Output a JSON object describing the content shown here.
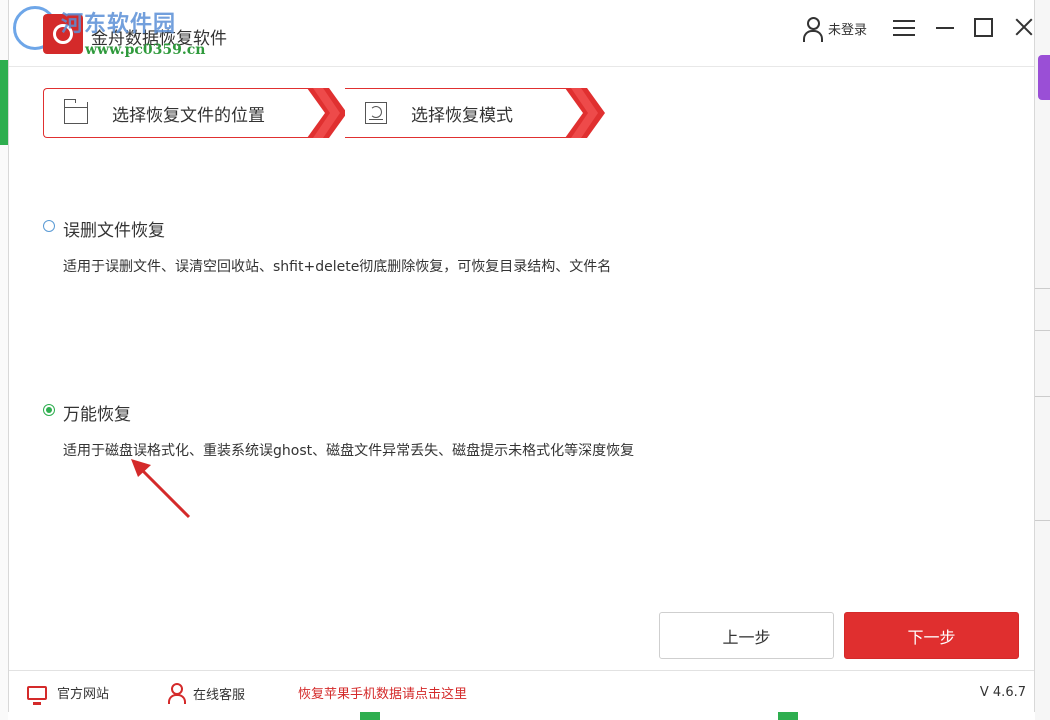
{
  "watermark": {
    "site_name": "河东软件园",
    "url": "www.pc0359.cn"
  },
  "app": {
    "title": "金舟数据恢复软件"
  },
  "user": {
    "login_label": "未登录"
  },
  "steps": [
    {
      "label": "选择恢复文件的位置",
      "icon": "folder-icon"
    },
    {
      "label": "选择恢复模式",
      "icon": "disk-recovery-icon"
    }
  ],
  "options": [
    {
      "title": "误删文件恢复",
      "description": "适用于误删文件、误清空回收站、shfit+delete彻底删除恢复，可恢复目录结构、文件名",
      "selected": false
    },
    {
      "title": "万能恢复",
      "description": "适用于磁盘误格式化、重装系统误ghost、磁盘文件异常丢失、磁盘提示未格式化等深度恢复",
      "selected": true
    }
  ],
  "buttons": {
    "prev": "上一步",
    "next": "下一步"
  },
  "footer": {
    "website": "官方网站",
    "support": "在线客服",
    "apple_link": "恢复苹果手机数据请点击这里",
    "version": "V 4.6.7"
  },
  "colors": {
    "accent": "#e02f2f",
    "radio_selected": "#2eae4f",
    "radio_unselected": "#5b9bd5"
  }
}
